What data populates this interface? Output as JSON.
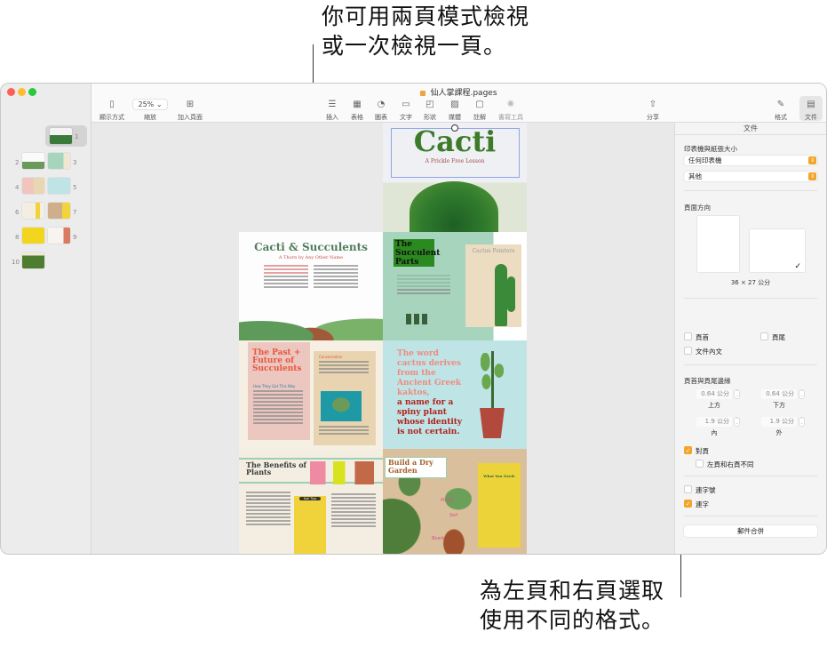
{
  "callouts": {
    "top": [
      "你可用兩頁模式檢視",
      "或一次檢視一頁。"
    ],
    "bottom": [
      "為左頁和右頁選取",
      "使用不同的格式。"
    ]
  },
  "window": {
    "title": "仙人掌課程.pages",
    "traffic_lights": {
      "close": "#fe5f57",
      "minimize": "#febc2e",
      "zoom": "#28c840"
    }
  },
  "toolbar": {
    "view": {
      "label": "顯示方式",
      "icon": "sidebar-icon"
    },
    "zoom": {
      "label": "縮放",
      "value": "25%"
    },
    "add_page": {
      "label": "加入頁面",
      "icon": "add-page-icon"
    },
    "insert": {
      "label": "插入",
      "icon": "insert-icon"
    },
    "table": {
      "label": "表格",
      "icon": "table-icon"
    },
    "chart": {
      "label": "圖表",
      "icon": "chart-icon"
    },
    "text": {
      "label": "文字",
      "icon": "text-icon"
    },
    "shape": {
      "label": "形狀",
      "icon": "shape-icon"
    },
    "media": {
      "label": "媒體",
      "icon": "media-icon"
    },
    "comment": {
      "label": "註解",
      "icon": "comment-icon"
    },
    "writing_tools": {
      "label": "書寫工具",
      "icon": "writing-tools-icon"
    },
    "share": {
      "label": "分享",
      "icon": "share-icon"
    },
    "format": {
      "label": "格式",
      "icon": "paintbrush-icon"
    },
    "document": {
      "label": "文件",
      "icon": "document-icon"
    }
  },
  "sidebar": {
    "thumbnails": [
      {
        "page": "1",
        "selected": true
      },
      {
        "page": "2"
      },
      {
        "page": "3"
      },
      {
        "page": "4"
      },
      {
        "page": "5"
      },
      {
        "page": "6"
      },
      {
        "page": "7"
      },
      {
        "page": "8"
      },
      {
        "page": "9"
      },
      {
        "page": "10"
      }
    ]
  },
  "pages": {
    "p1": {
      "title": "Cacti",
      "subtitle": "A Prickle Free Lesson"
    },
    "p2": {
      "title": "Cacti & Succulents",
      "subtitle": "A Thorn by Any Other Name"
    },
    "p3": {
      "title": "The Succulent Parts",
      "poster_title": "Cactus Pointers"
    },
    "p4": {
      "title": "The Past + Future of Succulents",
      "section": "How They Got This Way",
      "sidebar_head": "Conservation"
    },
    "p5": {
      "quote_light": "The word cactus derives from the Ancient Greek kaktos,",
      "quote_dark": "a name for a spiny plant whose identity is not certain."
    },
    "p6": {
      "title": "The Benefits of Plants",
      "box_title": "Soil Tips"
    },
    "p7": {
      "title": "Build a Dry Garden",
      "box_title": "What You Need:",
      "labels": [
        "Plants",
        "Soil",
        "Bowls"
      ]
    }
  },
  "inspector": {
    "tab": "文件",
    "printer_section": "印表機與紙張大小",
    "printer_value": "任何印表機",
    "paper_value": "其他",
    "orientation_section": "頁面方向",
    "paper_size": "36 × 27 公分",
    "header": {
      "label": "頁首",
      "checked": false
    },
    "footer": {
      "label": "頁尾",
      "checked": false
    },
    "body": {
      "label": "文件內文",
      "checked": false
    },
    "margins_section": "頁首與頁尾邊緣",
    "margins": {
      "top": {
        "value": "0.64 公分",
        "label": "上方"
      },
      "bottom": {
        "value": "0.64 公分",
        "label": "下方"
      },
      "inside": {
        "value": "1.9 公分",
        "label": "內"
      },
      "outside": {
        "value": "1.9 公分",
        "label": "外"
      }
    },
    "facing_pages": {
      "label": "對頁",
      "checked": true
    },
    "different_lr": {
      "label": "左頁和右頁不同",
      "checked": false
    },
    "hyphenation": {
      "label": "連字號",
      "checked": false
    },
    "ligatures": {
      "label": "連字",
      "checked": true
    },
    "mail_merge": "郵件合併"
  }
}
